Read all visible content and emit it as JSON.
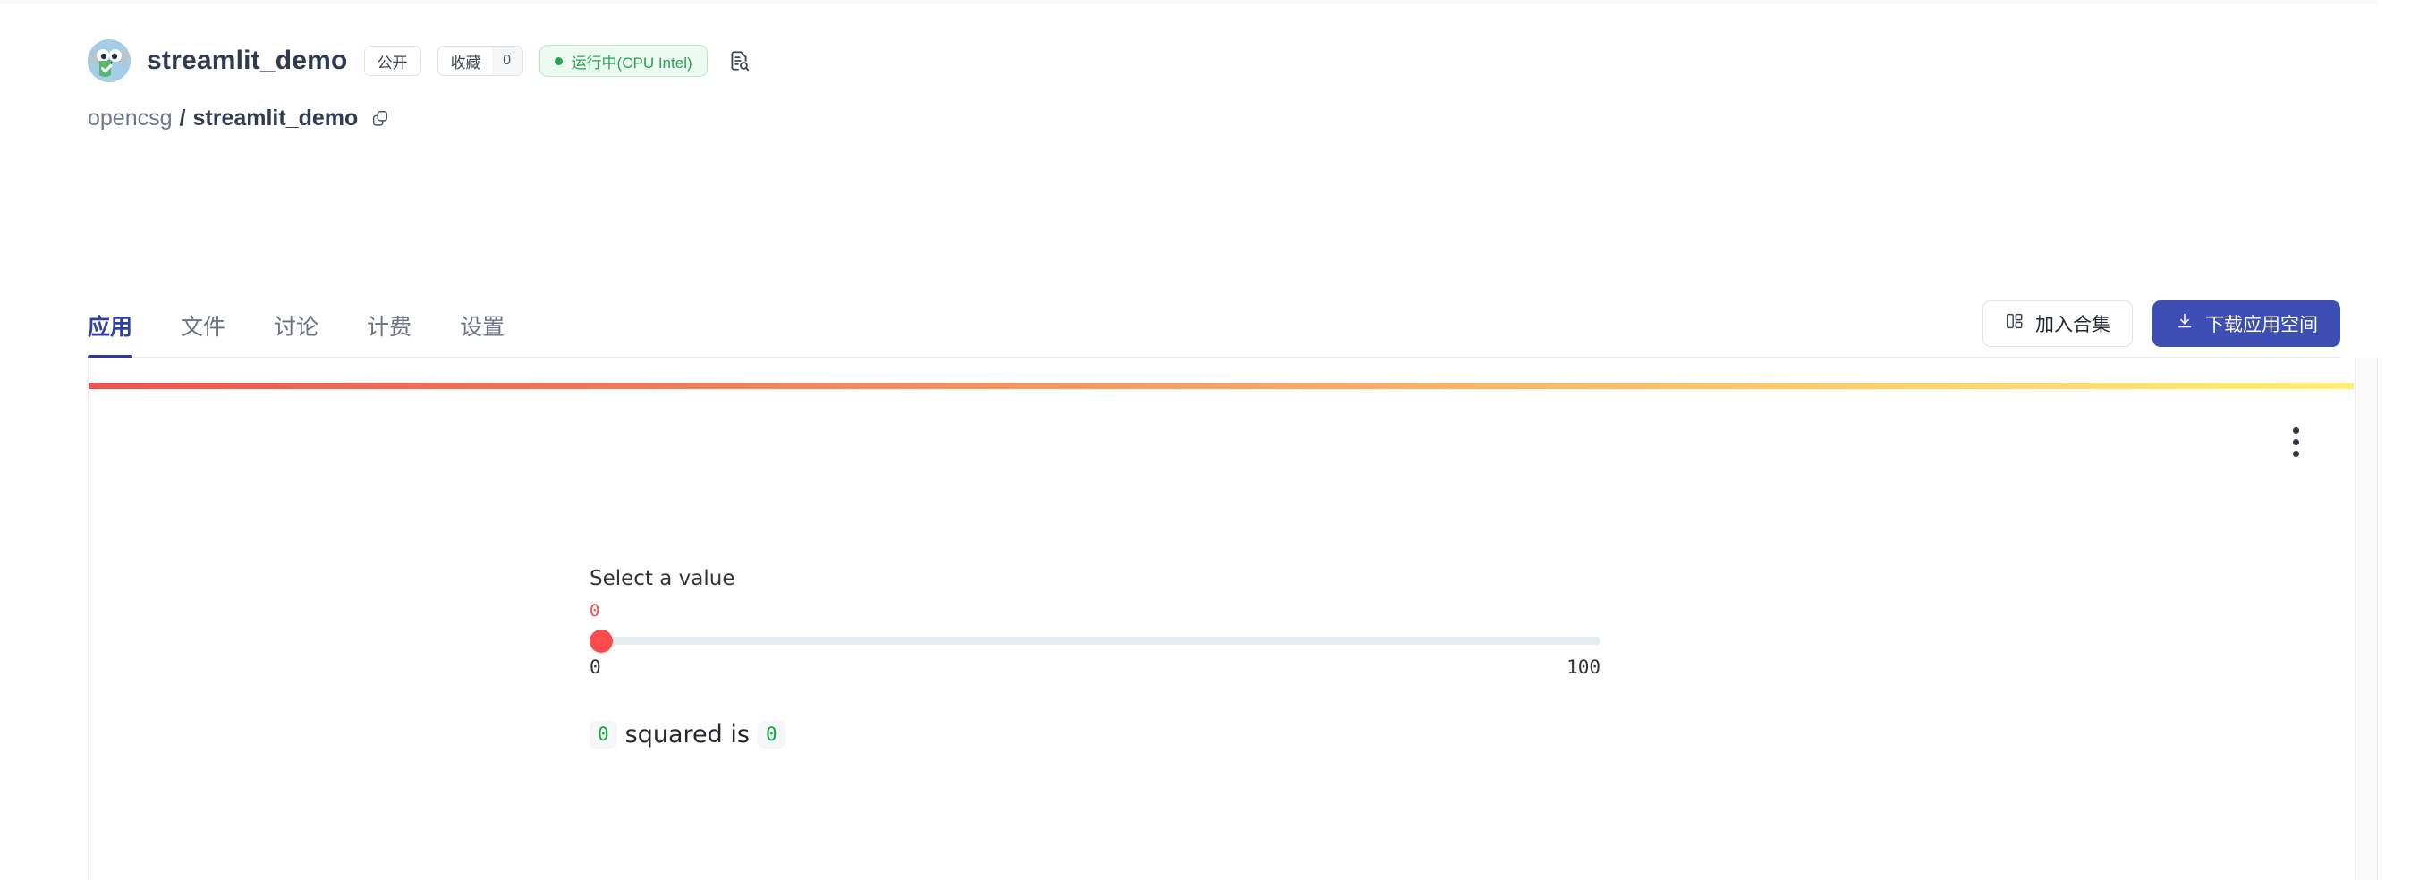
{
  "header": {
    "avatar_icon": "gopher-shield-avatar",
    "repo_title": "streamlit_demo",
    "visibility_tag": "公开",
    "stars_label": "收藏",
    "stars_count": "0",
    "status_text": "运行中(CPU Intel)",
    "logs_icon": "document-search-icon",
    "breadcrumb": {
      "owner": "opencsg",
      "separator": "/",
      "name": "streamlit_demo",
      "copy_icon": "copy-icon"
    }
  },
  "tabs": [
    {
      "label": "应用",
      "active": true
    },
    {
      "label": "文件",
      "active": false
    },
    {
      "label": "讨论",
      "active": false
    },
    {
      "label": "计费",
      "active": false
    },
    {
      "label": "设置",
      "active": false
    }
  ],
  "actions": {
    "collection_icon": "collection-layout-icon",
    "collection_label": "加入合集",
    "download_icon": "download-icon",
    "download_label": "下载应用空间"
  },
  "app": {
    "menu_icon": "kebab-menu-icon",
    "gradient_from": "#ef5350",
    "gradient_to": "#fff170",
    "slider": {
      "label": "Select a value",
      "value": "0",
      "min": "0",
      "max": "100",
      "thumb_color": "#ff4b4b",
      "track_color": "#e6eaf1",
      "percent": 0
    },
    "result": {
      "code_left": "0",
      "text": "squared is",
      "code_right": "0",
      "code_color": "#09ab3b"
    }
  },
  "colors": {
    "accent_blue": "#3d4fb5",
    "tab_active": "#2b38a0",
    "status_green": "#2ba158",
    "title": "#303a51"
  }
}
